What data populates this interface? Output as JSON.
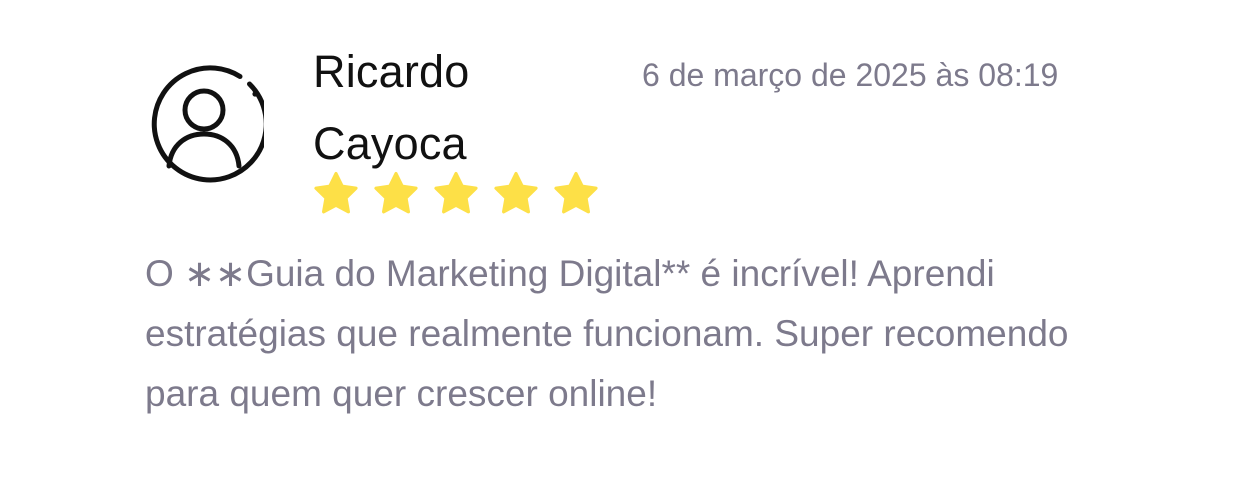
{
  "review": {
    "author_name": "Ricardo Cayoca",
    "date": "6 de março de 2025 às 08:19",
    "rating": 5,
    "rating_max": 5,
    "text": "O ∗∗Guia do Marketing Digital** é incrível! Aprendi estratégias que realmente funcionam. Super recomendo para quem quer crescer online!"
  },
  "icons": {
    "avatar": "user-avatar-icon",
    "star": "star-icon"
  },
  "colors": {
    "name": "#111111",
    "muted_text": "#7d7a8c",
    "star": "#fde047",
    "avatar_stroke": "#111111"
  }
}
